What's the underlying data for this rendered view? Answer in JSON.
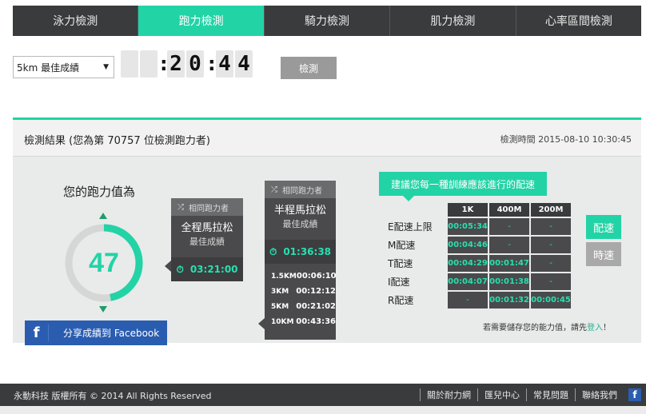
{
  "tabs": [
    "泳力檢測",
    "跑力檢測",
    "騎力檢測",
    "肌力檢測",
    "心率區間檢測"
  ],
  "form": {
    "event_selected": "5km 最佳成績",
    "digits": [
      "",
      "",
      "2",
      "0",
      "4",
      "4"
    ],
    "colon": ":",
    "submit_label": "檢測"
  },
  "result": {
    "title": "檢測結果 (您為第 70757 位檢測跑力者)",
    "time_label": "檢測時間 2015-08-10 10:30:45",
    "score_title": "您的跑力值為",
    "score": "47",
    "score_fraction": 0.47,
    "facebook_label": "分享成績到 Facebook"
  },
  "cards": {
    "full": {
      "head": "相同跑力者",
      "main": "全程馬拉松",
      "sub": "最佳成績",
      "time": "03:21:00"
    },
    "half": {
      "head": "相同跑力者",
      "main": "半程馬拉松",
      "sub": "最佳成績",
      "time": "01:36:38",
      "splits": [
        {
          "dist": "1.5KM",
          "time": "00:06:10"
        },
        {
          "dist": "3KM",
          "time": "00:12:12"
        },
        {
          "dist": "5KM",
          "time": "00:21:02"
        },
        {
          "dist": "10KM",
          "time": "00:43:36"
        }
      ]
    }
  },
  "pace": {
    "title": "建議您每一種訓練應該進行的配速",
    "headers": [
      "1K",
      "400M",
      "200M"
    ],
    "rows": [
      {
        "label": "E配速上限",
        "values": [
          "00:05:34",
          "-",
          "-"
        ]
      },
      {
        "label": "M配速",
        "values": [
          "00:04:46",
          "-",
          "-"
        ]
      },
      {
        "label": "T配速",
        "values": [
          "00:04:29",
          "00:01:47",
          "-"
        ]
      },
      {
        "label": "I配速",
        "values": [
          "00:04:07",
          "00:01:38",
          "-"
        ]
      },
      {
        "label": "R配速",
        "values": [
          "-",
          "00:01:32",
          "00:00:45"
        ]
      }
    ],
    "side_pace": "配速",
    "side_speed": "時速",
    "save_note_prefix": "若需要儲存您的能力值，請先",
    "save_note_link": "登入",
    "save_note_suffix": "！"
  },
  "footer": {
    "copyright": "永動科技  版權所有 © 2014 All Rights Reserved",
    "links": [
      "關於耐力網",
      "匯兒中心",
      "常見問題",
      "聯絡我們"
    ]
  },
  "colors": {
    "accent": "#22d3a6",
    "dark": "#3a3b3d",
    "facebook": "#2a5db0"
  },
  "icons": [
    "shuffle-icon",
    "stopwatch-icon",
    "facebook-icon"
  ]
}
